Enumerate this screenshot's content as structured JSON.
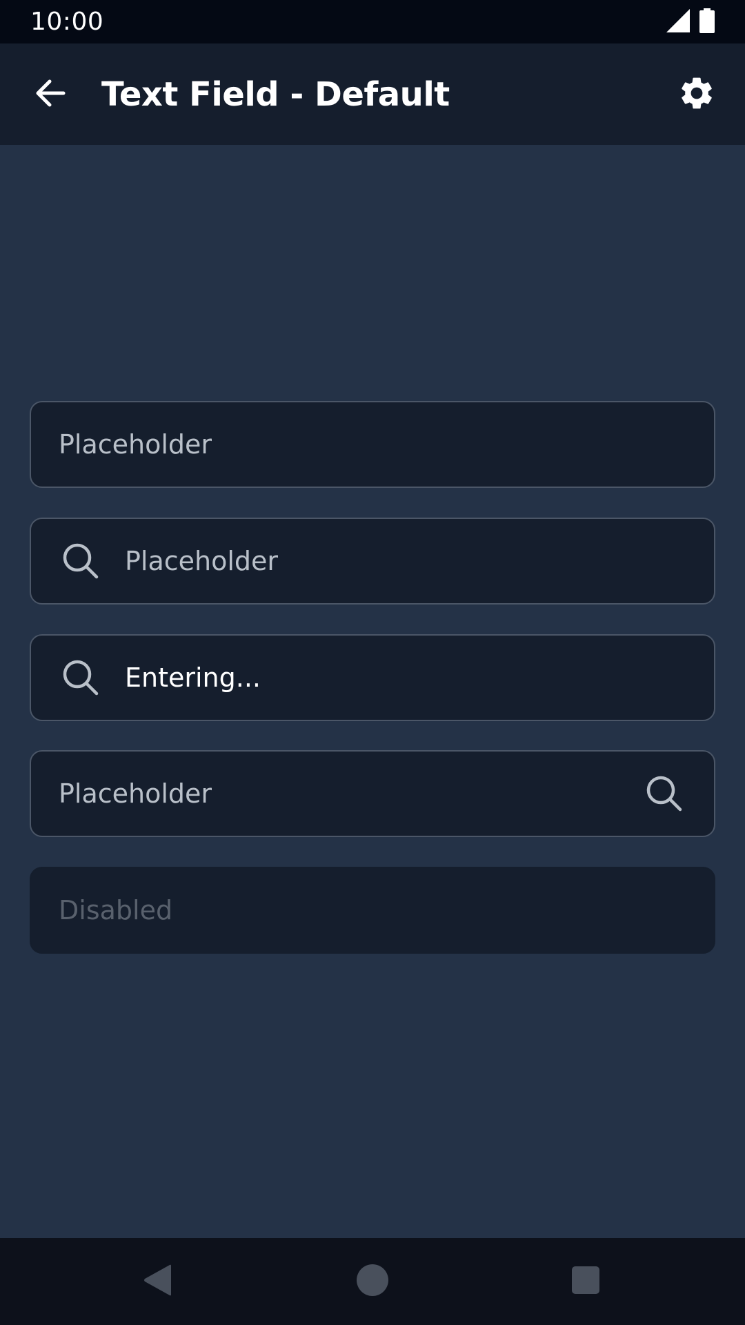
{
  "status_bar": {
    "time": "10:00",
    "icons": [
      "signal-icon",
      "battery-icon"
    ]
  },
  "app_bar": {
    "title": "Text Field - Default",
    "back_icon": "arrow-back-icon",
    "settings_icon": "gear-icon"
  },
  "fields": [
    {
      "placeholder": "Placeholder",
      "value": "",
      "icon": "none",
      "state": "default"
    },
    {
      "placeholder": "Placeholder",
      "value": "",
      "icon": "search-icon-leading",
      "state": "default"
    },
    {
      "placeholder": "",
      "value": "Entering...",
      "icon": "search-icon-leading",
      "state": "entering"
    },
    {
      "placeholder": "Placeholder",
      "value": "",
      "icon": "search-icon-trailing",
      "state": "default"
    },
    {
      "placeholder": "Disabled",
      "value": "",
      "icon": "none",
      "state": "disabled"
    }
  ],
  "nav_bar": {
    "icons": [
      "nav-back-icon",
      "nav-home-icon",
      "nav-recents-icon"
    ]
  },
  "colors": {
    "background": "#243247",
    "app_bar": "#151e2d",
    "status_bar": "#040914",
    "field_bg": "#151e2d",
    "field_border": "#4b5667",
    "placeholder": "#b9c0c9",
    "disabled_text": "#59616d",
    "nav_bar": "#0d111b"
  }
}
